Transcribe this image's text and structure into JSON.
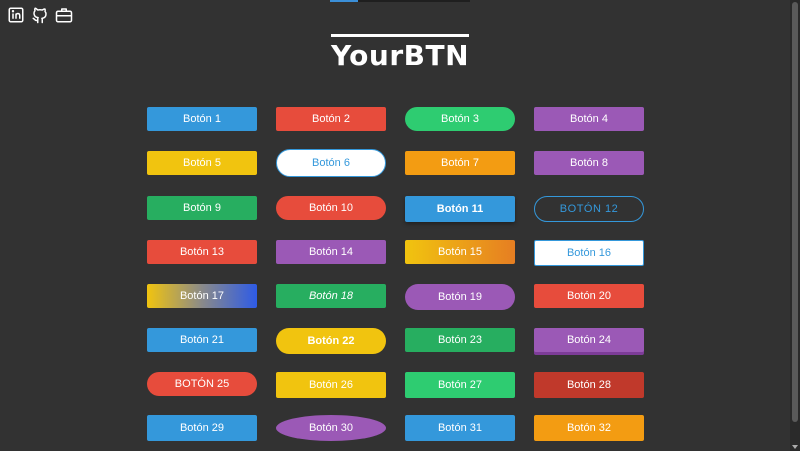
{
  "header": {
    "title": "YourBTN"
  },
  "social": {
    "icons": [
      "linkedin-icon",
      "github-icon",
      "briefcase-icon"
    ]
  },
  "buttons": [
    {
      "label": "Botón 1",
      "bg": "#3498db"
    },
    {
      "label": "Botón 2",
      "bg": "#e74c3c"
    },
    {
      "label": "Botón 3",
      "bg": "#2ecc71"
    },
    {
      "label": "Botón 4",
      "bg": "#9b59b6"
    },
    {
      "label": "Botón 5",
      "bg": "#f1c40f"
    },
    {
      "label": "Botón 6",
      "bg": "#ffffff",
      "color": "#3498db",
      "border": "#3498db"
    },
    {
      "label": "Botón 7",
      "bg": "#f39c12"
    },
    {
      "label": "Botón 8",
      "bg": "#9b59b6"
    },
    {
      "label": "Botón 9",
      "bg": "#27ae60"
    },
    {
      "label": "Botón 10",
      "bg": "#e74c3c"
    },
    {
      "label": "Botón 11",
      "bg": "#3498db"
    },
    {
      "label": "BOTÓN 12",
      "bg": "transparent",
      "color": "#3498db",
      "border": "#3498db"
    },
    {
      "label": "Botón 13",
      "bg": "#e74c3c"
    },
    {
      "label": "Botón 14",
      "bg": "#9b59b6"
    },
    {
      "label": "Botón 15",
      "bg": "linear-gradient(90deg,#f1c40f,#e67e22)"
    },
    {
      "label": "Botón 16",
      "bg": "#ffffff",
      "color": "#3498db",
      "border": "#3498db"
    },
    {
      "label": "Botón 17",
      "bg": "linear-gradient(90deg,#f1c40f,#8a8a8a,#2e5be6)"
    },
    {
      "label": "Botón 18",
      "bg": "#27ae60"
    },
    {
      "label": "Botón 19",
      "bg": "#9b59b6"
    },
    {
      "label": "Botón 20",
      "bg": "#e74c3c"
    },
    {
      "label": "Botón 21",
      "bg": "#3498db"
    },
    {
      "label": "Botón 22",
      "bg": "#f1c40f"
    },
    {
      "label": "Botón 23",
      "bg": "#27ae60"
    },
    {
      "label": "Botón 24",
      "bg": "#9b59b6"
    },
    {
      "label": "BOTÓN 25",
      "bg": "#e74c3c"
    },
    {
      "label": "Botón 26",
      "bg": "#f1c40f"
    },
    {
      "label": "Botón 27",
      "bg": "#2ecc71"
    },
    {
      "label": "Botón 28",
      "bg": "#c0392b"
    },
    {
      "label": "Botón 29",
      "bg": "#3498db"
    },
    {
      "label": "Botón 30",
      "bg": "#9b59b6"
    },
    {
      "label": "Botón 31",
      "bg": "#3498db"
    },
    {
      "label": "Botón 32",
      "bg": "#f39c12"
    }
  ]
}
